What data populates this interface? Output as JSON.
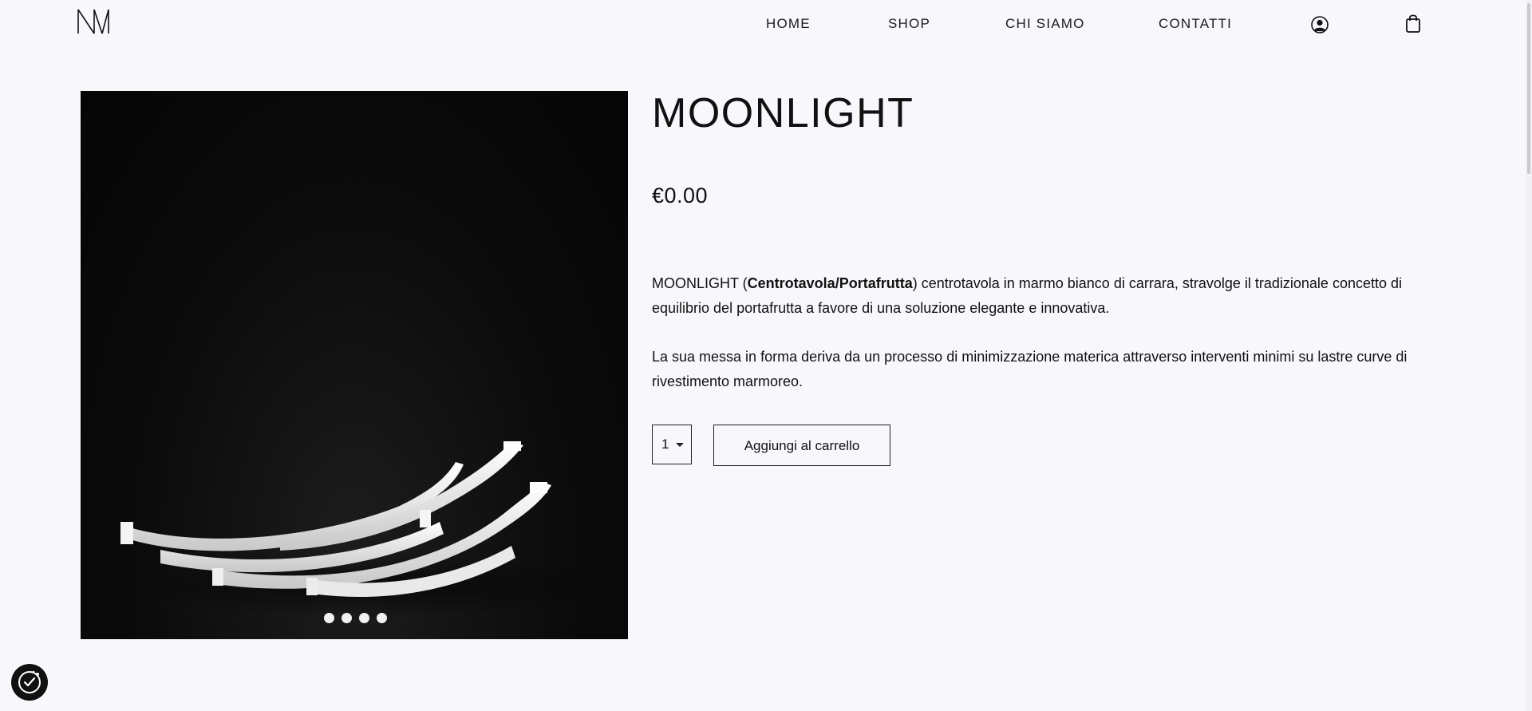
{
  "header": {
    "logo_text": "NM",
    "nav": {
      "home": "HOME",
      "shop": "SHOP",
      "chi_siamo": "CHI SIAMO",
      "contatti": "CONTATTI"
    },
    "icons": [
      "user-account-icon",
      "shopping-bag-icon"
    ]
  },
  "product": {
    "title": "MOONLIGHT",
    "price": "€0.00",
    "description": {
      "p1_prefix": "MOONLIGHT (",
      "p1_bold": "Centrotavola/Portafrutta",
      "p1_suffix": ") centrotavola in marmo bianco di carrara, stravolge il tradizionale concetto di equilibrio del portafrutta a favore di una soluzione elegante e innovativa.",
      "p2": "La sua messa in forma deriva da un processo di minimizzazione materica attraverso interventi minimi su lastre curve di rivestimento marmoreo."
    },
    "quantity": "1",
    "add_to_cart_label": "Aggiungi al carrello",
    "gallery": {
      "slide_count": 4,
      "active_index": 0
    }
  },
  "colors": {
    "background": "#f8f7fc",
    "text": "#111111",
    "image_background": "#0b0b0b"
  },
  "widgets": {
    "cookie_badge_icon": "cookie-consent-icon"
  }
}
